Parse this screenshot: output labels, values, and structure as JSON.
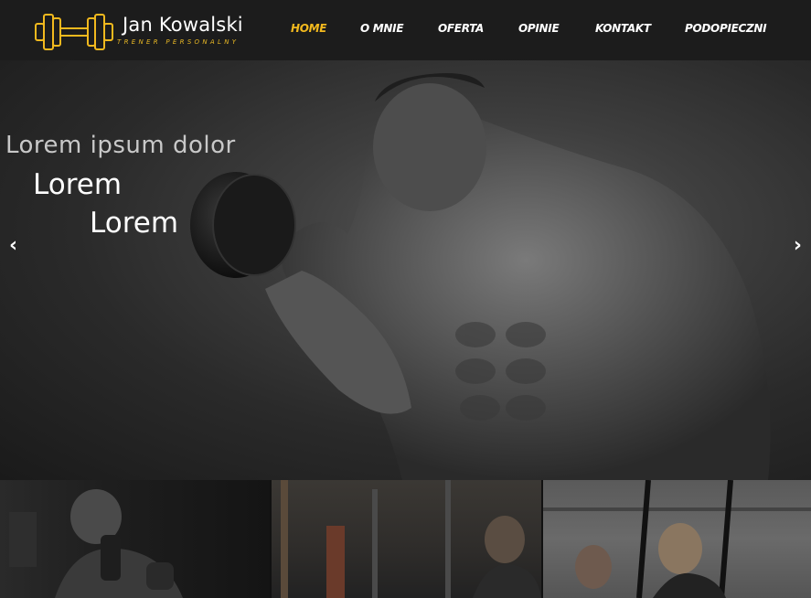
{
  "logo": {
    "name": "Jan Kowalski",
    "subtitle": "TRENER PERSONALNY",
    "accent": "#f2b91e"
  },
  "nav": {
    "items": [
      {
        "label": "HOME",
        "active": true
      },
      {
        "label": "O MNIE",
        "active": false
      },
      {
        "label": "OFERTA",
        "active": false
      },
      {
        "label": "OPINIE",
        "active": false
      },
      {
        "label": "KONTAKT",
        "active": false
      },
      {
        "label": "PODOPIECZNI",
        "active": false
      }
    ]
  },
  "hero": {
    "title": "Lorem ipsum dolor",
    "line2": "Lorem",
    "line3": "Lorem",
    "prev_icon": "‹",
    "next_icon": "›"
  }
}
